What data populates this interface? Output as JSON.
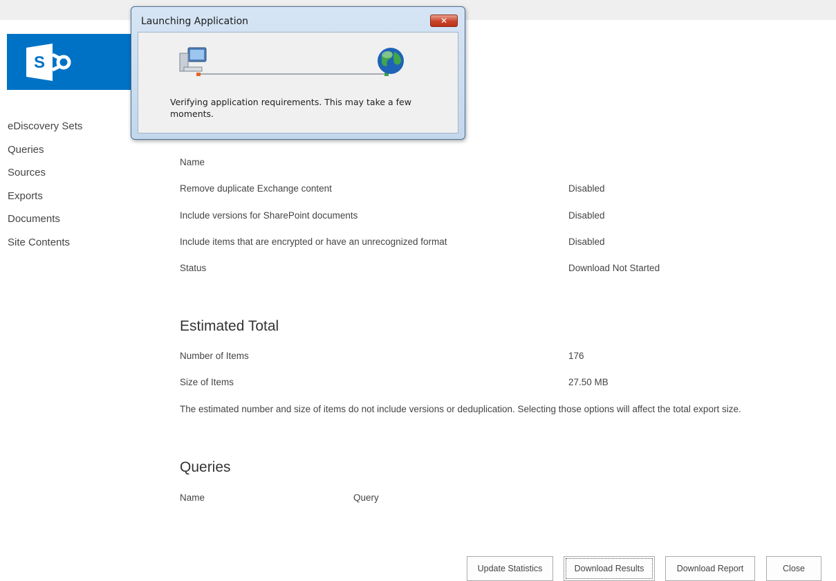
{
  "nav": {
    "items": [
      {
        "label": "eDiscovery Sets"
      },
      {
        "label": "Queries"
      },
      {
        "label": "Sources"
      },
      {
        "label": "Exports"
      },
      {
        "label": "Documents"
      },
      {
        "label": "Site Contents"
      }
    ]
  },
  "options": {
    "name_label": "Name",
    "rows": [
      {
        "label": "Remove duplicate Exchange content",
        "value": "Disabled"
      },
      {
        "label": "Include versions for SharePoint documents",
        "value": "Disabled"
      },
      {
        "label": "Include items that are encrypted or have an unrecognized format",
        "value": "Disabled"
      },
      {
        "label": "Status",
        "value": "Download Not Started"
      }
    ]
  },
  "estimated": {
    "title": "Estimated Total",
    "rows": [
      {
        "label": "Number of Items",
        "value": "176"
      },
      {
        "label": "Size of Items",
        "value": "27.50 MB"
      }
    ],
    "note": "The estimated number and size of items do not include versions or deduplication. Selecting those options will affect the total export size."
  },
  "queries": {
    "title": "Queries",
    "col_name": "Name",
    "col_query": "Query"
  },
  "buttons": {
    "update": "Update Statistics",
    "download_results": "Download Results",
    "download_report": "Download Report",
    "close": "Close"
  },
  "dialog": {
    "title": "Launching Application",
    "message": "Verifying application requirements. This may take a few moments.",
    "close_glyph": "✕",
    "progress": 0
  },
  "colors": {
    "brand": "#0072c6",
    "dialog_frame": "#c3d7ec",
    "close_button": "#c9432a"
  }
}
